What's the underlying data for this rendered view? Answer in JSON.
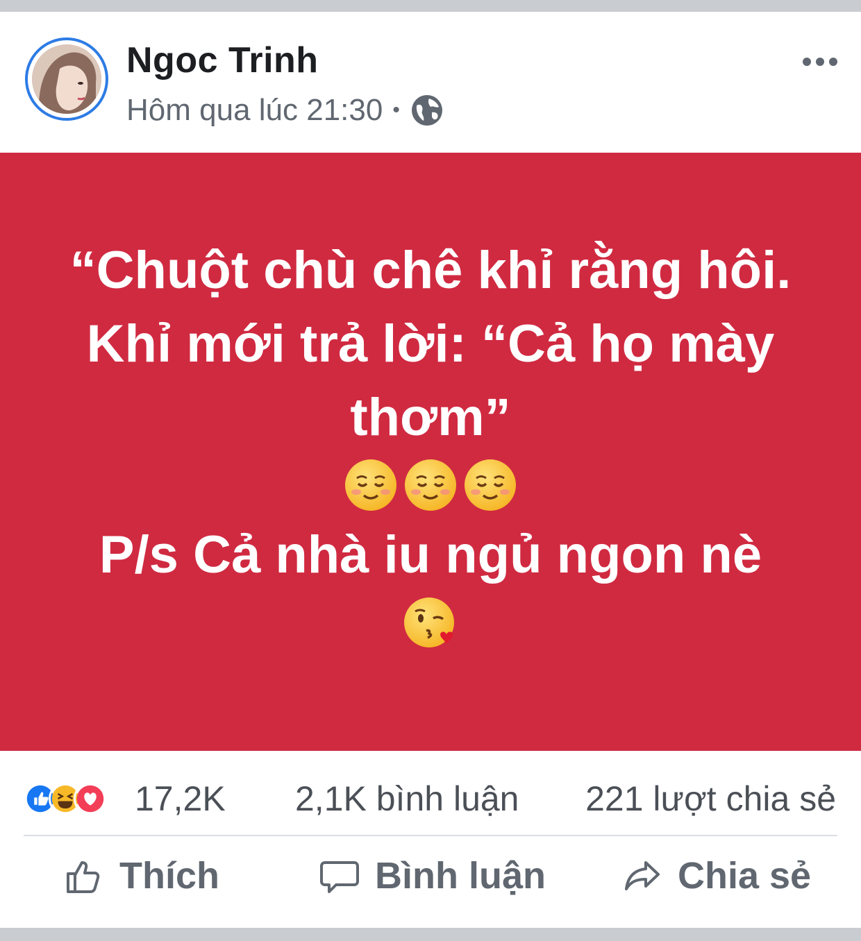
{
  "post": {
    "author": "Ngoc Trinh",
    "timestamp": "Hôm qua lúc 21:30",
    "separator": "•",
    "privacy_icon": "globe-icon",
    "menu_icon": "more-options-icon"
  },
  "status": {
    "line1": "“Chuột chù chê khỉ rằng hôi. Khỉ mới trả lời: “Cả họ mày thơm”",
    "line2": "P/s Cả nhà iu ngủ ngon nè",
    "background_color": "#d02a41",
    "emojis_row1": [
      "smiling-face-icon",
      "smiling-face-icon",
      "smiling-face-icon"
    ],
    "emojis_row2": [
      "face-blowing-kiss-icon"
    ]
  },
  "stats": {
    "reactions": [
      "like-reaction-icon",
      "haha-reaction-icon",
      "love-reaction-icon"
    ],
    "reaction_count": "17,2K",
    "comments": "2,1K bình luận",
    "shares": "221 lượt chia sẻ"
  },
  "actions": {
    "like": "Thích",
    "comment": "Bình luận",
    "share": "Chia sẻ"
  }
}
